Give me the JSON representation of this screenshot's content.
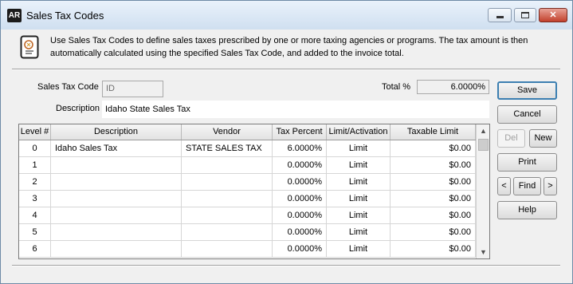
{
  "window": {
    "app_badge": "AR",
    "title": "Sales Tax Codes",
    "controls": {
      "minimize_icon": "minimize-icon",
      "maximize_icon": "maximize-icon",
      "close_icon": "close-icon"
    }
  },
  "info": {
    "icon": "document-icon",
    "text": "Use Sales Tax Codes to define sales taxes prescribed by one or more taxing agencies or programs. The tax amount is then automatically calculated using the specified Sales Tax Code, and added to the invoice total."
  },
  "form": {
    "sales_tax_code_label": "Sales Tax Code",
    "sales_tax_code_value": "ID",
    "total_percent_label": "Total %",
    "total_percent_value": "6.0000%",
    "description_label": "Description",
    "description_value": "Idaho State Sales Tax"
  },
  "grid": {
    "columns": [
      "Level #",
      "Description",
      "Vendor",
      "Tax Percent",
      "Limit/Activation",
      "Taxable Limit"
    ],
    "rows": [
      [
        "0",
        "Idaho Sales Tax",
        "STATE SALES TAX",
        "6.0000%",
        "Limit",
        "$0.00"
      ],
      [
        "1",
        "",
        "",
        "0.0000%",
        "Limit",
        "$0.00"
      ],
      [
        "2",
        "",
        "",
        "0.0000%",
        "Limit",
        "$0.00"
      ],
      [
        "3",
        "",
        "",
        "0.0000%",
        "Limit",
        "$0.00"
      ],
      [
        "4",
        "",
        "",
        "0.0000%",
        "Limit",
        "$0.00"
      ],
      [
        "5",
        "",
        "",
        "0.0000%",
        "Limit",
        "$0.00"
      ],
      [
        "6",
        "",
        "",
        "0.0000%",
        "Limit",
        "$0.00"
      ]
    ]
  },
  "buttons": {
    "save": "Save",
    "cancel": "Cancel",
    "del": "Del",
    "new": "New",
    "print": "Print",
    "prev": "<",
    "find": "Find",
    "next": ">",
    "help": "Help"
  }
}
